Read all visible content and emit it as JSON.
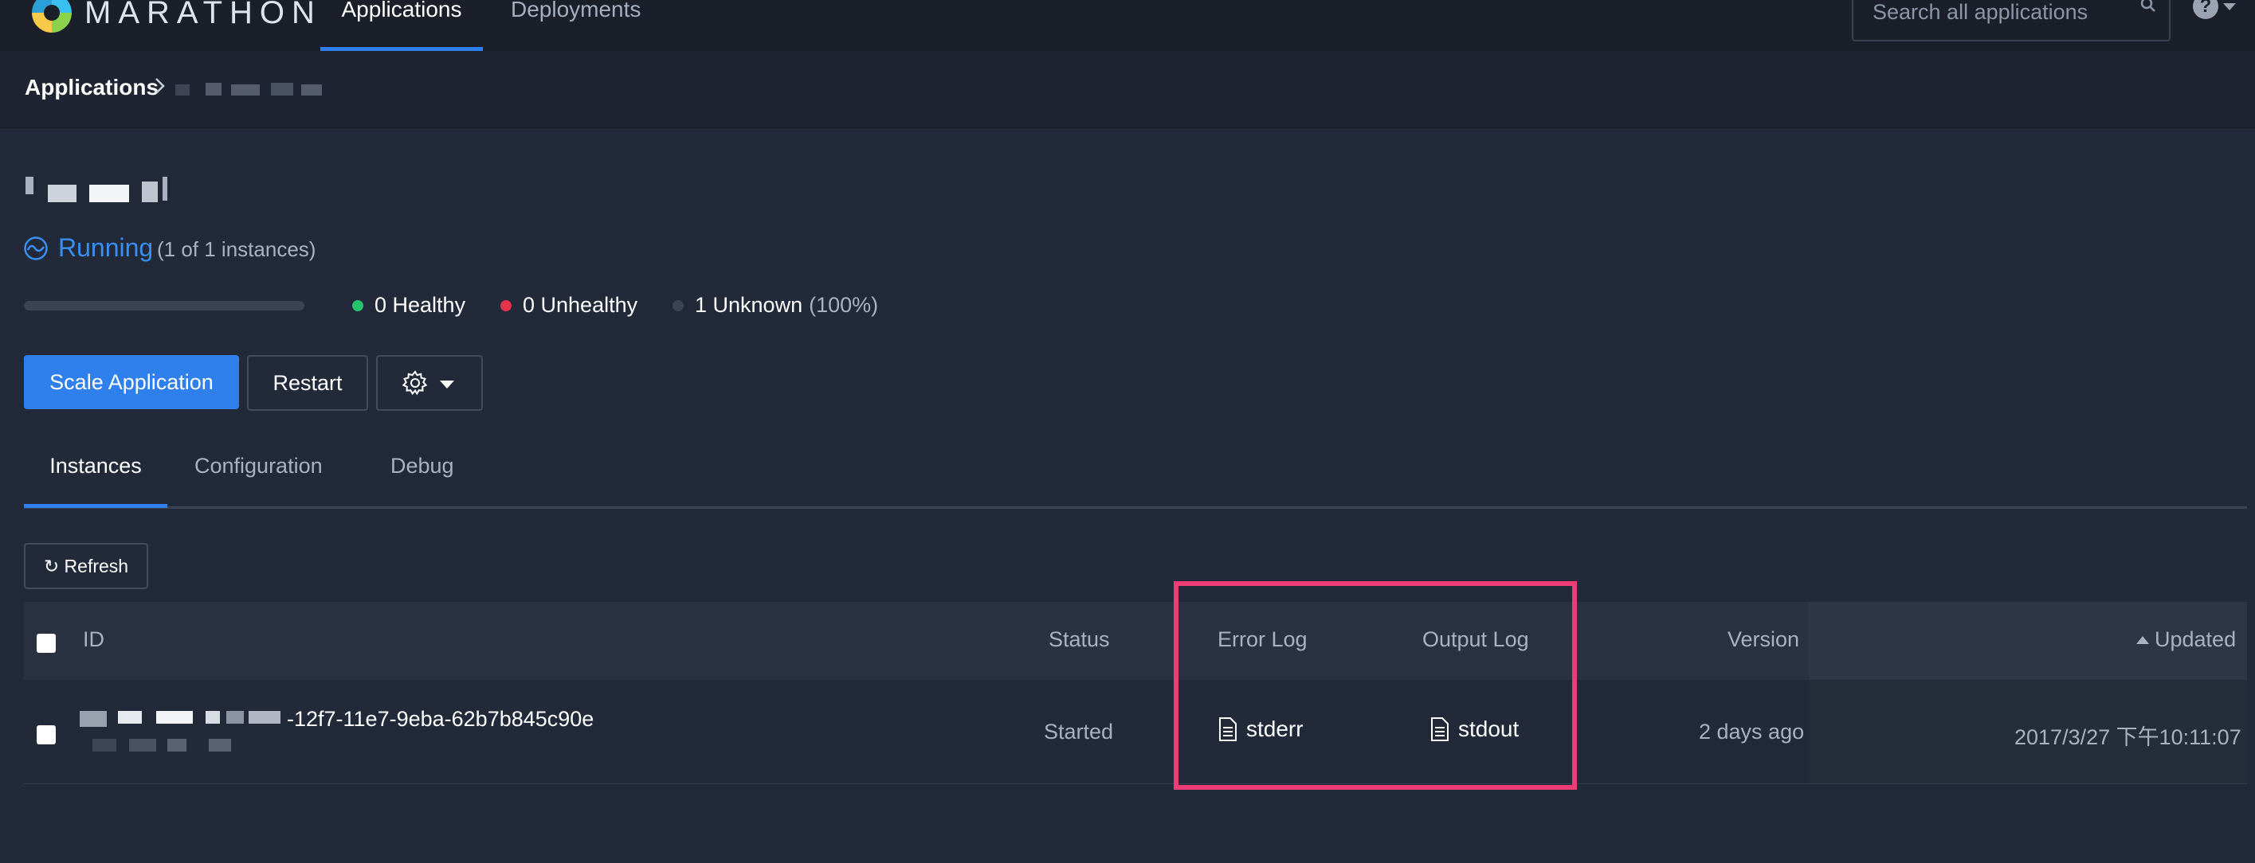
{
  "nav": {
    "logo_text": "MARATHON",
    "tabs": [
      {
        "label": "Applications",
        "active": true
      },
      {
        "label": "Deployments",
        "active": false
      }
    ],
    "search_placeholder": "Search all applications",
    "help_glyph": "?",
    "icons": [
      "marathon-logo",
      "search-icon",
      "help-icon",
      "chevron-down-icon"
    ]
  },
  "breadcrumb": {
    "root": "Applications",
    "separator_icon": "chevron-right-icon"
  },
  "app": {
    "status": "Running",
    "instances_summary": "(1 of 1 instances)",
    "health": {
      "healthy": "0 Healthy",
      "unhealthy": "0 Unhealthy",
      "unknown": "1 Unknown",
      "unknown_pct": "(100%)"
    },
    "colors": {
      "accent": "#2f80ed",
      "healthy": "#27c26c",
      "unhealthy": "#e5344a",
      "unknown": "#3b4354",
      "highlight": "#ec3d74"
    }
  },
  "actions": {
    "scale": "Scale Application",
    "restart": "Restart",
    "settings_icon": "gear-icon"
  },
  "tabs": [
    {
      "label": "Instances",
      "active": true
    },
    {
      "label": "Configuration",
      "active": false
    },
    {
      "label": "Debug",
      "active": false
    }
  ],
  "refresh_label": "↻ Refresh",
  "table": {
    "columns": [
      "ID",
      "Status",
      "Error Log",
      "Output Log",
      "Version",
      "Updated"
    ],
    "sort_column": "Updated",
    "rows": [
      {
        "id_suffix": "-12f7-11e7-9eba-62b7b845c90e",
        "status": "Started",
        "error_log": "stderr",
        "output_log": "stdout",
        "version": "2 days ago",
        "updated": "2017/3/27 下午10:11:07"
      }
    ]
  }
}
